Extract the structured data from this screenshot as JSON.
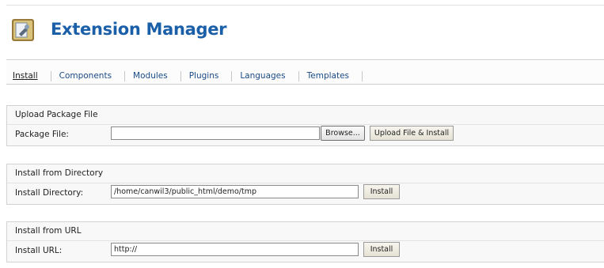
{
  "header": {
    "title": "Extension Manager",
    "logo_icon": "extension-manager-icon"
  },
  "submenu": {
    "items": [
      {
        "label": "Install",
        "active": true
      },
      {
        "label": "Components"
      },
      {
        "label": "Modules"
      },
      {
        "label": "Plugins"
      },
      {
        "label": "Languages"
      },
      {
        "label": "Templates"
      }
    ]
  },
  "upload": {
    "title": "Upload Package File",
    "label": "Package File:",
    "value": "",
    "browse_label": "Browse...",
    "submit_label": "Upload File & Install"
  },
  "directory": {
    "title": "Install from Directory",
    "label": "Install Directory:",
    "value": "/home/canwil3/public_html/demo/tmp",
    "submit_label": "Install"
  },
  "url": {
    "title": "Install from URL",
    "label": "Install URL:",
    "value": "http://",
    "submit_label": "Install"
  },
  "colors": {
    "title": "#1a5fa8",
    "link": "#1a4b86",
    "panel_bg": "#f8f8f8"
  }
}
